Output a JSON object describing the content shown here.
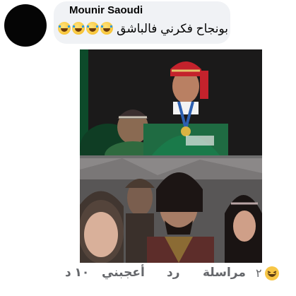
{
  "comment": {
    "author": "Mounir Saoudi",
    "text": "بونجاح فكرني فالباشق",
    "emoji_icons": [
      "laughing-tears-icon",
      "laughing-tears-icon",
      "laughing-tears-icon",
      "laughing-tears-icon"
    ]
  },
  "actions": {
    "time": "١٠ د",
    "like_label": "أعجبني",
    "reply_label": "رد",
    "message_label": "مراسلة"
  },
  "reactions": {
    "count": "٢",
    "icon": "haha-reaction-icon"
  }
}
